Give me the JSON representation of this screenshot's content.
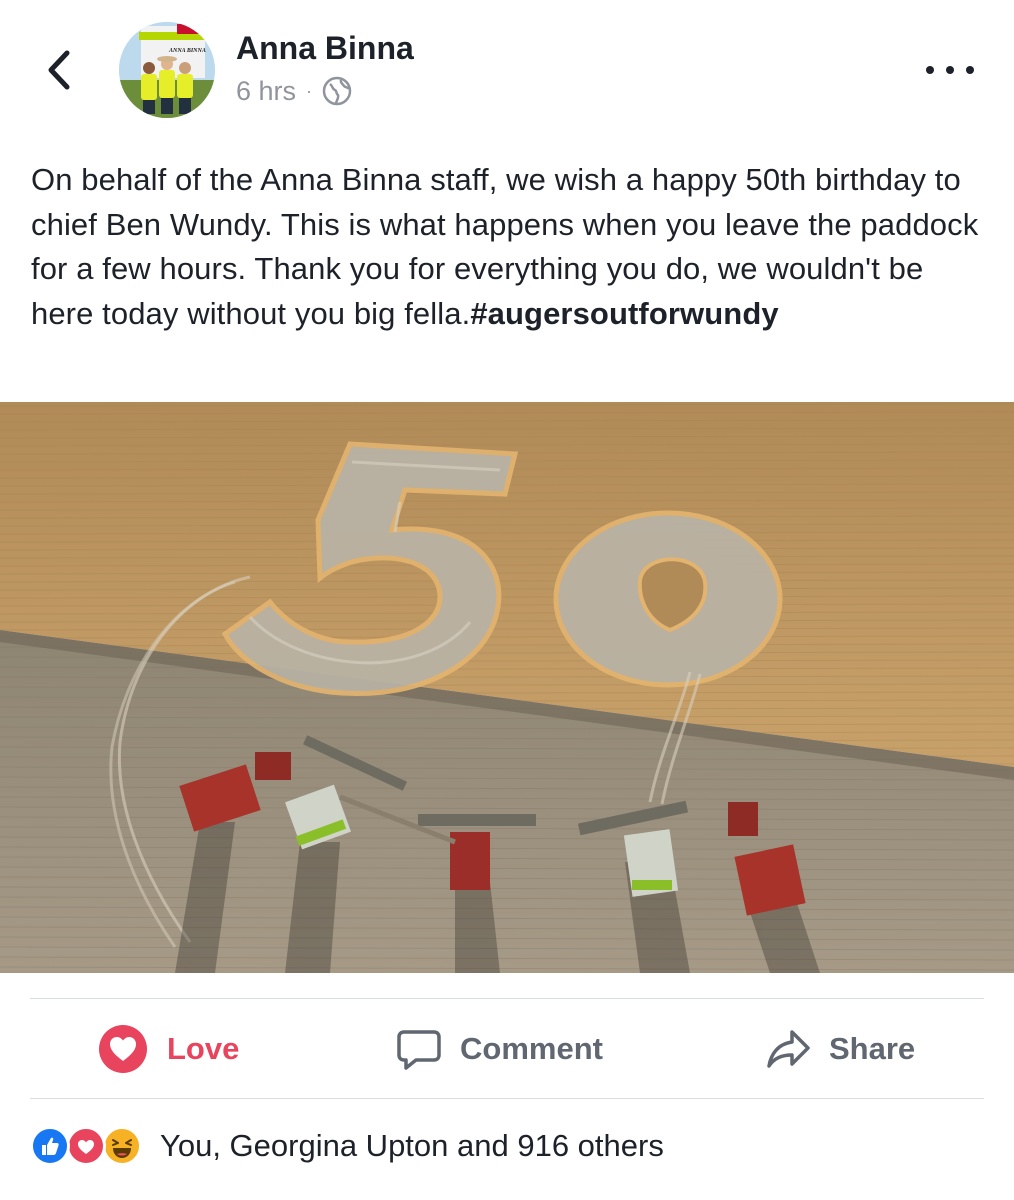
{
  "header": {
    "author": "Anna Binna",
    "time": "6 hrs",
    "separator": "·",
    "privacy_icon": "globe-icon",
    "avatar_banner_text": "ANNA BINNA"
  },
  "post": {
    "text": "On behalf of the Anna Binna staff, we wish a happy 50th birthday to chief Ben Wundy. This is what happens when you leave the paddock for a few hours. Thank you for everything you do, we wouldn't be here today without you big fella.",
    "hashtag": "#augersoutforwundy"
  },
  "photo": {
    "subject": "aerial view of wheat paddock with 50 harvested into crop and harvesters lined up"
  },
  "actions": {
    "love_label": "Love",
    "comment_label": "Comment",
    "share_label": "Share"
  },
  "reactions": {
    "summary": "You, Georgina Upton and 916 others",
    "icons": [
      "like-icon",
      "love-icon",
      "haha-icon"
    ]
  },
  "colors": {
    "love": "#e8445e",
    "like": "#1877f2",
    "haha": "#f7b125",
    "muted": "#606770",
    "meta": "#90949c",
    "divider": "#dadde1"
  }
}
